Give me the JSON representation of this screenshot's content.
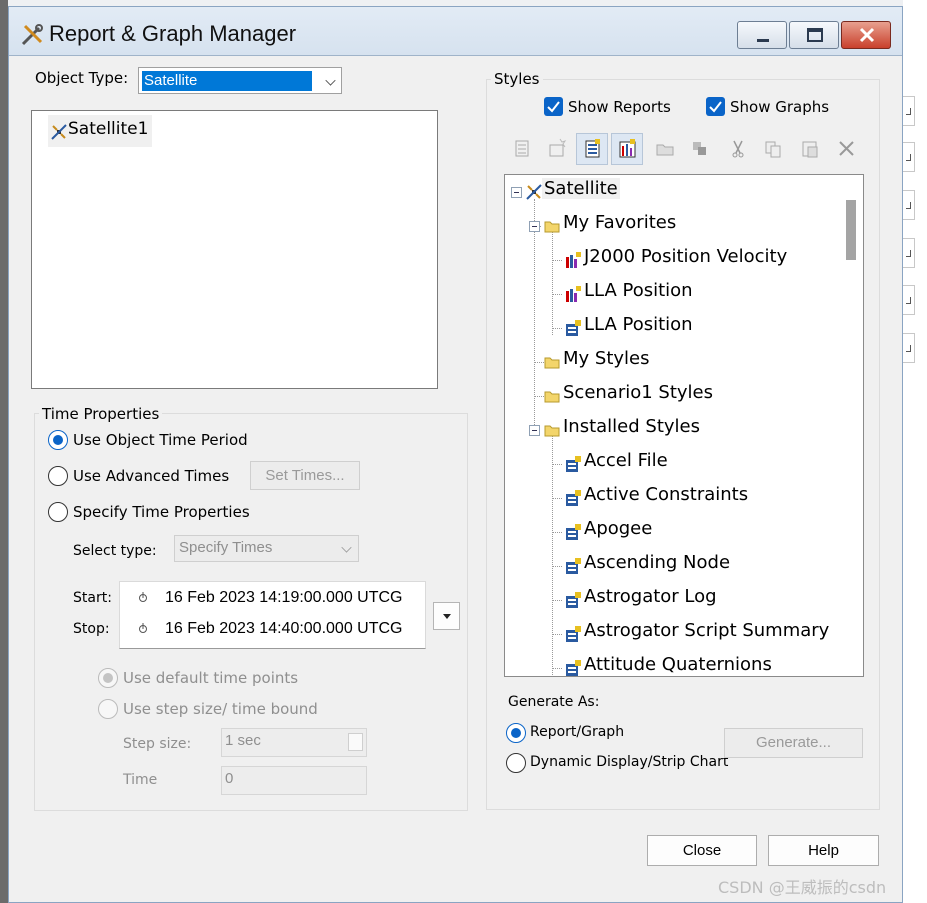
{
  "window": {
    "title": "Report & Graph Manager"
  },
  "object_type": {
    "label": "Object Type:",
    "value": "Satellite"
  },
  "objects": [
    {
      "label": "Satellite1"
    }
  ],
  "time_properties": {
    "title": "Time Properties",
    "options": [
      {
        "label": "Use Object Time Period",
        "selected": true
      },
      {
        "label": "Use Advanced Times",
        "selected": false
      },
      {
        "label": "Specify Time Properties",
        "selected": false
      }
    ],
    "set_times_label": "Set Times...",
    "select_type_label": "Select type:",
    "select_type_value": "Specify Times",
    "start_label": "Start:",
    "stop_label": "Stop:",
    "start_value": "16 Feb 2023 14:19:00.000 UTCG",
    "stop_value": "16 Feb 2023 14:40:00.000 UTCG",
    "sub_options": [
      {
        "label": "Use default time points",
        "selected": true
      },
      {
        "label": "Use step size/ time bound",
        "selected": false
      }
    ],
    "step_size_label": "Step size:",
    "step_size_value": "1 sec",
    "time_label": "Time",
    "time_value": "0"
  },
  "styles": {
    "title": "Styles",
    "show_reports_label": "Show Reports",
    "show_graphs_label": "Show Graphs",
    "show_reports": true,
    "show_graphs": true,
    "toolbar_icons": [
      "new-report-icon",
      "new-graph-icon",
      "report-style-icon",
      "graph-style-icon",
      "open-folder-icon",
      "properties-icon",
      "cut-icon",
      "copy-icon",
      "paste-icon",
      "delete-icon"
    ],
    "tree": {
      "root": "Satellite",
      "favorites": "My Favorites",
      "favorites_items": [
        "J2000 Position Velocity",
        "LLA Position",
        "LLA Position"
      ],
      "my_styles": "My Styles",
      "scenario_styles": "Scenario1 Styles",
      "installed": "Installed Styles",
      "installed_items": [
        "Accel File",
        "Active Constraints",
        "Apogee",
        "Ascending Node",
        "Astrogator Log",
        "Astrogator Script Summary",
        "Attitude Quaternions"
      ]
    }
  },
  "generate": {
    "title": "Generate As:",
    "options": [
      {
        "label": "Report/Graph",
        "selected": true
      },
      {
        "label": "Dynamic Display/Strip Chart",
        "selected": false
      }
    ],
    "button_label": "Generate..."
  },
  "footer": {
    "close_label": "Close",
    "help_label": "Help"
  },
  "watermark": "CSDN @王威振的csdn",
  "colors": {
    "accent": "#0a64c8",
    "selection": "#0078d7",
    "dialog_bg": "#f0f0f0"
  }
}
